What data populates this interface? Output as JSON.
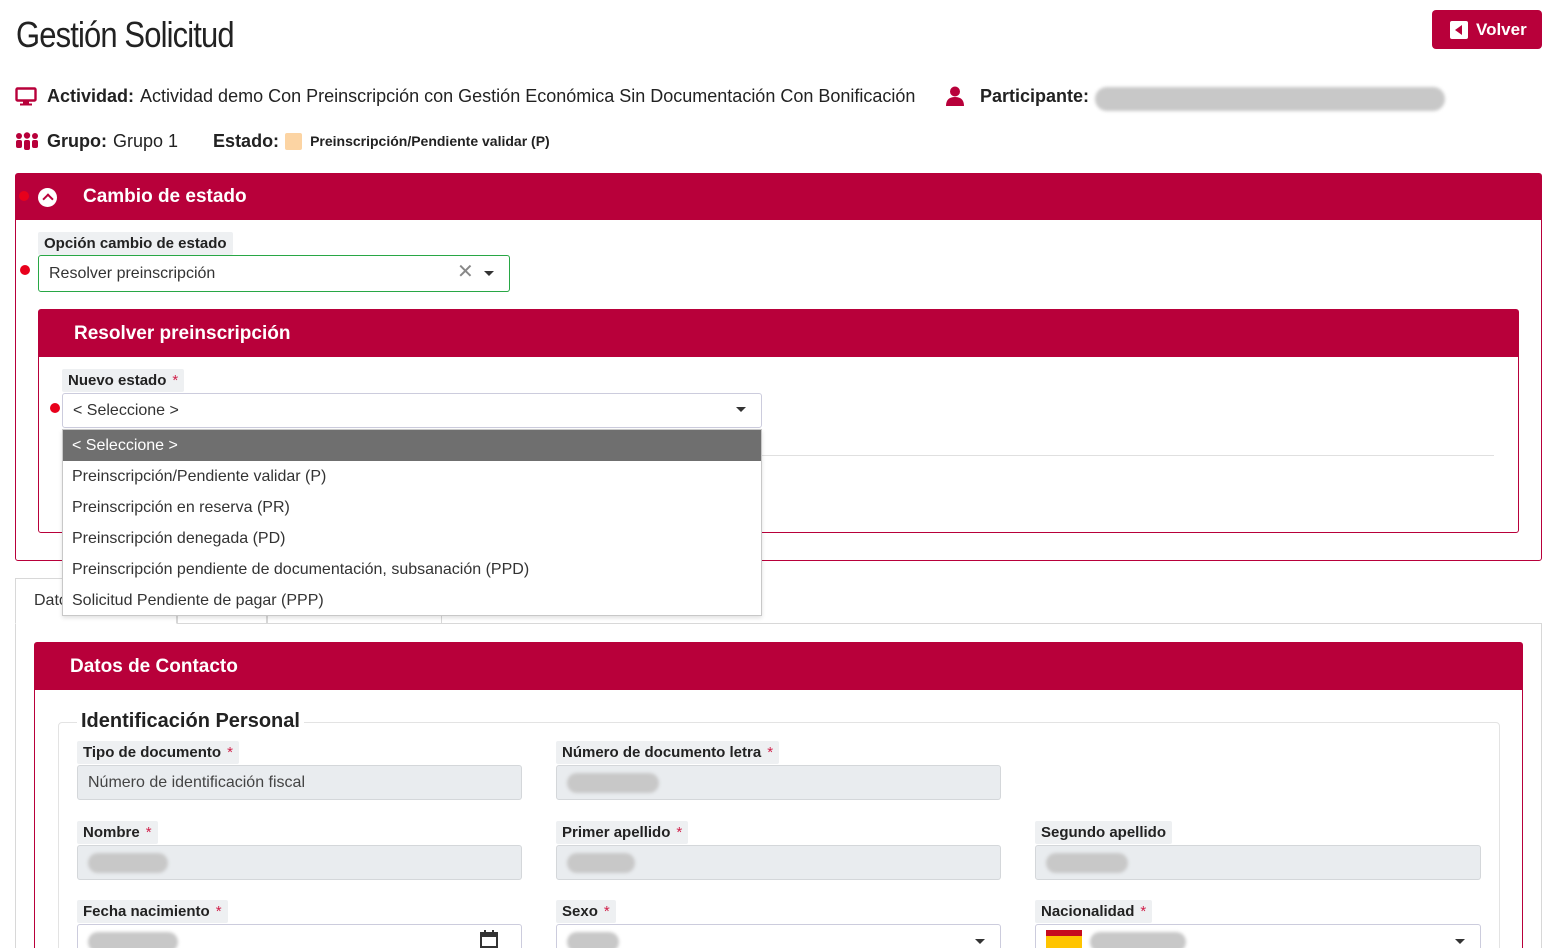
{
  "header": {
    "title": "Gestión Solicitud",
    "back_label": "Volver"
  },
  "info": {
    "actividad_label": "Actividad:",
    "actividad_value": "Actividad demo Con Preinscripción con Gestión Económica Sin Documentación Con Bonificación",
    "participante_label": "Participante:",
    "grupo_label": "Grupo:",
    "grupo_value": "Grupo 1",
    "estado_label": "Estado:",
    "estado_value": "Preinscripción/Pendiente validar (P)",
    "estado_color": "#fcd4a3"
  },
  "cambio_estado": {
    "title": "Cambio de estado",
    "option_label": "Opción cambio de estado",
    "option_value": "Resolver preinscripción"
  },
  "resolver": {
    "title": "Resolver preinscripción",
    "nuevo_estado_label": "Nuevo estado",
    "required_mark": "*",
    "select_value": "< Seleccione >",
    "options": [
      "< Seleccione >",
      "Preinscripción/Pendiente validar (P)",
      "Preinscripción en reserva (PR)",
      "Preinscripción denegada (PD)",
      "Preinscripción pendiente de documentación, subsanación (PPD)",
      "Solicitud Pendiente de pagar (PPP)"
    ],
    "selected_option_index": 0
  },
  "tabs": {
    "first_tab_partial": "Dato"
  },
  "contacto": {
    "title": "Datos de Contacto",
    "section_title": "Identificación Personal",
    "fields": {
      "tipo_documento": {
        "label": "Tipo de documento",
        "value": "Número de identificación fiscal"
      },
      "numero_documento": {
        "label": "Número de documento letra"
      },
      "nombre": {
        "label": "Nombre"
      },
      "primer_apellido": {
        "label": "Primer apellido"
      },
      "segundo_apellido": {
        "label": "Segundo apellido"
      },
      "fecha_nacimiento": {
        "label": "Fecha nacimiento"
      },
      "sexo": {
        "label": "Sexo"
      },
      "nacionalidad": {
        "label": "Nacionalidad"
      }
    }
  },
  "colors": {
    "brand": "#b8003a",
    "required_dot": "#e8001c",
    "focus_border": "#28a745"
  },
  "icons": {
    "actividad": "monitor-icon",
    "participante": "user-icon",
    "grupo": "users-group-icon",
    "volver": "arrow-left-square-icon",
    "collapse": "chevron-up-circle-icon",
    "clear": "close-icon",
    "calendar": "calendar-icon",
    "flag": "spain-flag-icon"
  }
}
